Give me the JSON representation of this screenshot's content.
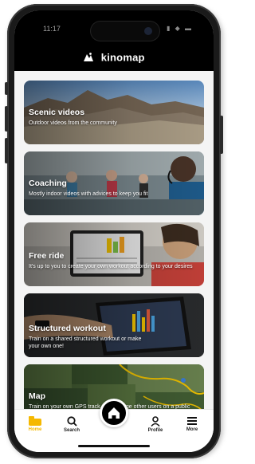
{
  "status": {
    "time": "11:17",
    "icons": "▮ ◆ ▬"
  },
  "brand": {
    "name": "kinomap"
  },
  "cards": [
    {
      "title": "Scenic videos",
      "desc": "Outdoor videos from the community"
    },
    {
      "title": "Coaching",
      "desc": "Mostly indoor videos with advices to keep you fit"
    },
    {
      "title": "Free ride",
      "desc": "It's up to you to create your own workout according to your desires"
    },
    {
      "title": "Structured workout",
      "desc": "Train on a shared structured workout or make your own one!"
    },
    {
      "title": "Map",
      "desc": "Train on your own GPS track or challenge other users on a public track"
    }
  ],
  "tabs": {
    "home": "Home",
    "search": "Search",
    "profile": "Profile",
    "more": "More"
  },
  "colors": {
    "accent": "#f5b800",
    "bar": "#000000"
  }
}
